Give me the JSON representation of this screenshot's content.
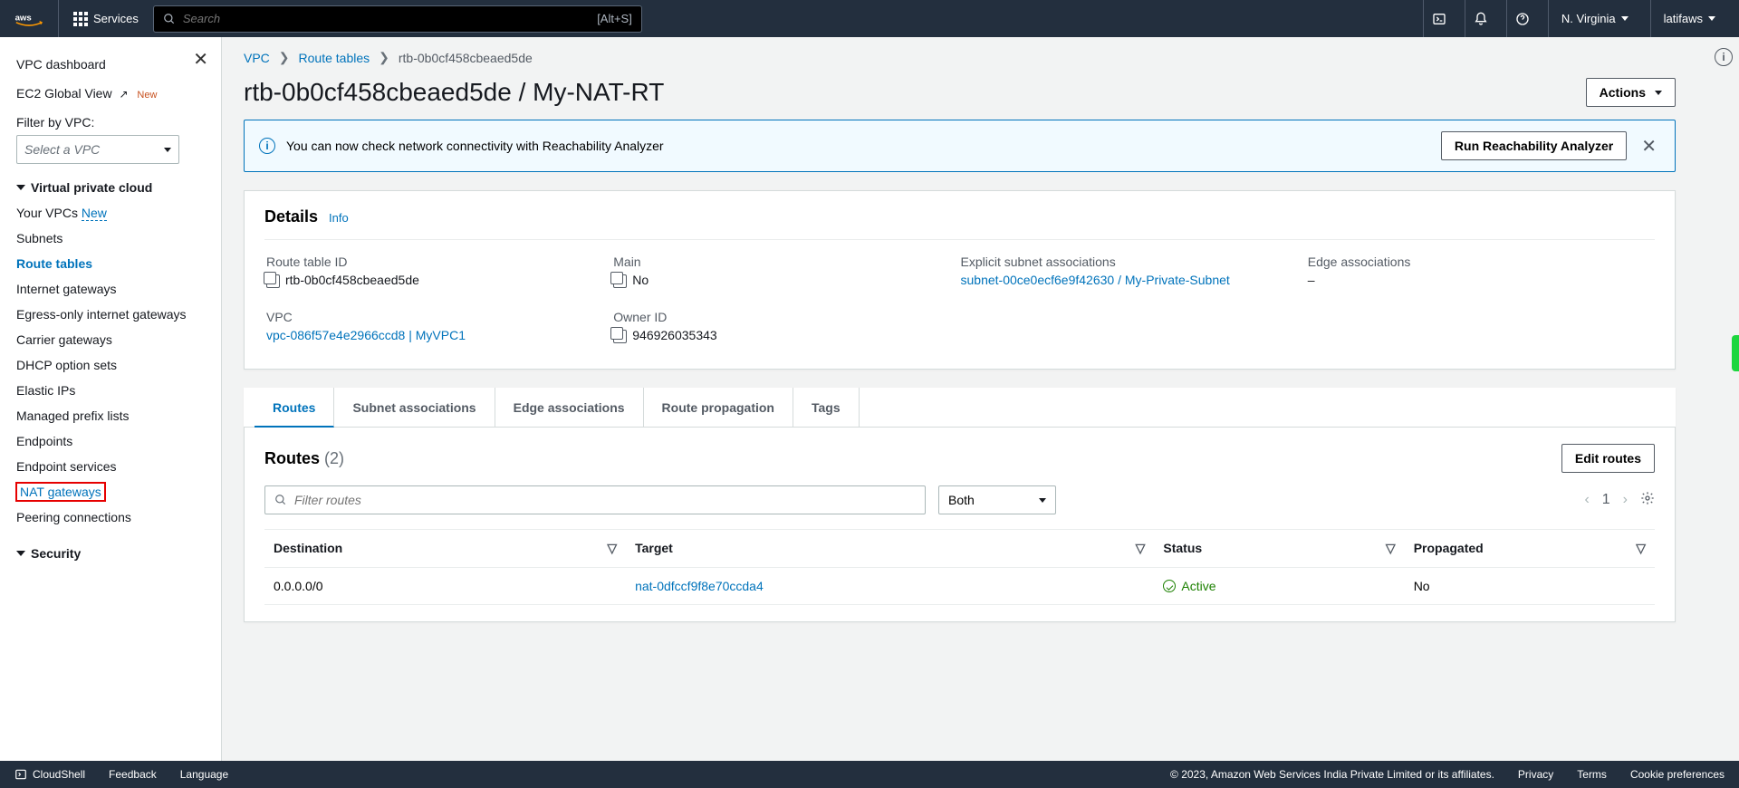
{
  "topnav": {
    "services": "Services",
    "search_placeholder": "Search",
    "search_shortcut": "[Alt+S]",
    "region": "N. Virginia",
    "user": "latifaws"
  },
  "sidebar": {
    "dashboard": "VPC dashboard",
    "global_view": "EC2 Global View",
    "new_badge": "New",
    "filter_label": "Filter by VPC:",
    "select_placeholder": "Select a VPC",
    "section_vpc": "Virtual private cloud",
    "items": {
      "your_vpcs": "Your VPCs",
      "subnets": "Subnets",
      "route_tables": "Route tables",
      "internet_gateways": "Internet gateways",
      "egress_igw": "Egress-only internet gateways",
      "carrier_gateways": "Carrier gateways",
      "dhcp": "DHCP option sets",
      "elastic_ips": "Elastic IPs",
      "managed_prefix": "Managed prefix lists",
      "endpoints": "Endpoints",
      "endpoint_services": "Endpoint services",
      "nat_gateways": "NAT gateways",
      "peering": "Peering connections"
    },
    "section_security": "Security"
  },
  "breadcrumbs": {
    "vpc": "VPC",
    "route_tables": "Route tables",
    "current": "rtb-0b0cf458cbeaed5de"
  },
  "page": {
    "title": "rtb-0b0cf458cbeaed5de / My-NAT-RT",
    "actions": "Actions"
  },
  "flash": {
    "msg": "You can now check network connectivity with Reachability Analyzer",
    "run_btn": "Run Reachability Analyzer"
  },
  "details": {
    "heading": "Details",
    "info": "Info",
    "route_table_id": {
      "label": "Route table ID",
      "value": "rtb-0b0cf458cbeaed5de"
    },
    "main": {
      "label": "Main",
      "value": "No"
    },
    "explicit": {
      "label": "Explicit subnet associations",
      "value": "subnet-00ce0ecf6e9f42630 / My-Private-Subnet"
    },
    "edge": {
      "label": "Edge associations",
      "value": "–"
    },
    "vpc": {
      "label": "VPC",
      "value": "vpc-086f57e4e2966ccd8 | MyVPC1"
    },
    "owner": {
      "label": "Owner ID",
      "value": "946926035343"
    }
  },
  "tabs": {
    "routes": "Routes",
    "subnet_assoc": "Subnet associations",
    "edge_assoc": "Edge associations",
    "route_prop": "Route propagation",
    "tags": "Tags"
  },
  "routes": {
    "heading": "Routes",
    "count": "(2)",
    "edit_btn": "Edit routes",
    "filter_placeholder": "Filter routes",
    "both": "Both",
    "page_num": "1",
    "columns": {
      "destination": "Destination",
      "target": "Target",
      "status": "Status",
      "propagated": "Propagated"
    },
    "rows": [
      {
        "destination": "0.0.0.0/0",
        "target": "nat-0dfccf9f8e70ccda4",
        "status": "Active",
        "propagated": "No"
      }
    ]
  },
  "footer": {
    "cloudshell": "CloudShell",
    "feedback": "Feedback",
    "language": "Language",
    "copyright": "© 2023, Amazon Web Services India Private Limited or its affiliates.",
    "privacy": "Privacy",
    "terms": "Terms",
    "cookie": "Cookie preferences"
  }
}
